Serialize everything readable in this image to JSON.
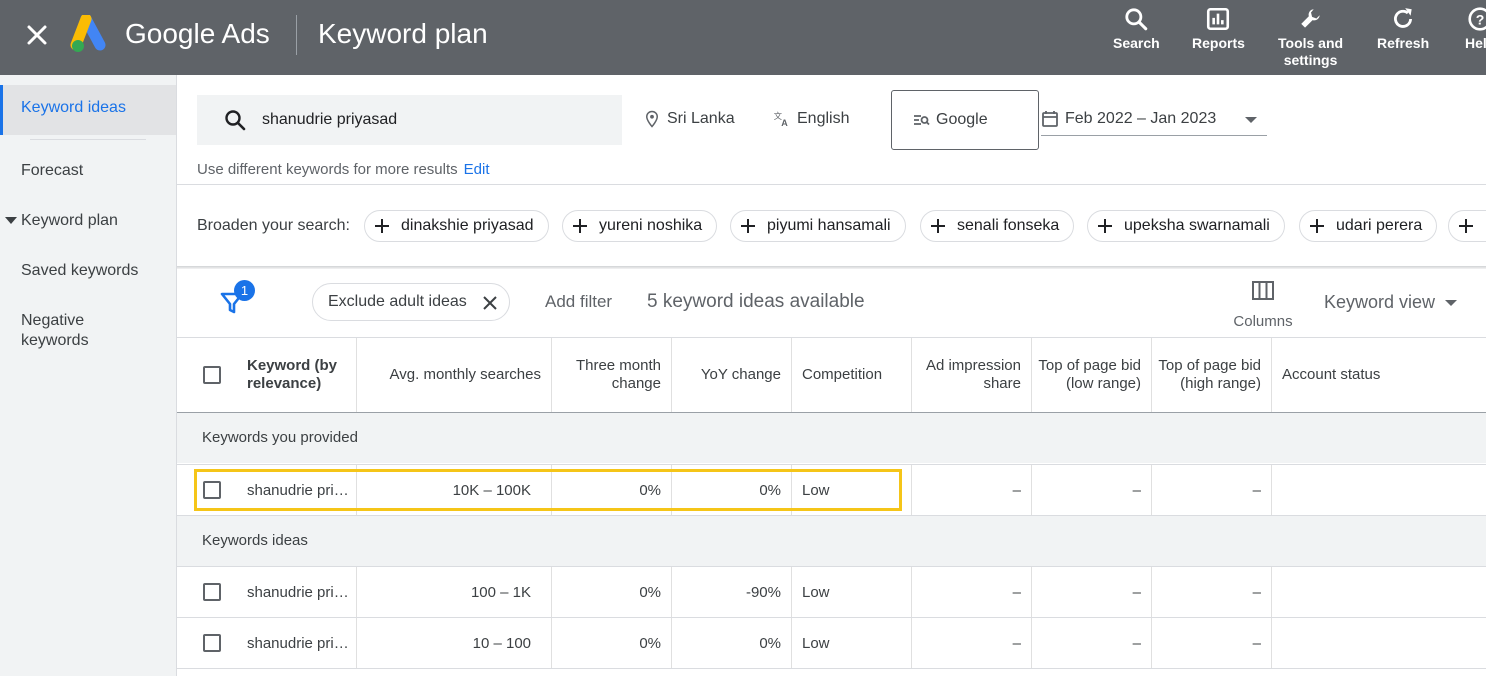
{
  "topbar": {
    "brand": "Google Ads",
    "title": "Keyword plan",
    "actions": [
      {
        "label": "Search",
        "icon": "search-icon"
      },
      {
        "label": "Reports",
        "icon": "reports-icon"
      },
      {
        "label": "Tools and\nsettings",
        "icon": "wrench-icon"
      },
      {
        "label": "Refresh",
        "icon": "refresh-icon"
      },
      {
        "label": "Help",
        "icon": "help-icon"
      }
    ]
  },
  "sidebar": {
    "items": [
      {
        "label": "Keyword ideas",
        "active": true
      },
      {
        "label": "Forecast"
      },
      {
        "label": "Keyword plan"
      },
      {
        "label": "Saved keywords"
      },
      {
        "label": "Negative\nkeywords"
      }
    ]
  },
  "search": {
    "query": "shanudrie priyasad",
    "location": "Sri Lanka",
    "language": "English",
    "network": "Google",
    "date_range": "Feb 2022 – Jan 2023",
    "hint": "Use different keywords for more results",
    "edit_label": "Edit"
  },
  "broaden": {
    "label": "Broaden your search:",
    "chips": [
      "dinakshie priyasad",
      "yureni noshika",
      "piyumi hansamali",
      "senali fonseka",
      "upeksha swarnamali",
      "udari perera"
    ]
  },
  "filters": {
    "badge": "1",
    "active_filter": "Exclude adult ideas",
    "add_filter": "Add filter",
    "count_text": "5 keyword ideas available",
    "columns_label": "Columns",
    "view_label": "Keyword view"
  },
  "table": {
    "headers": [
      "Keyword (by relevance)",
      "Avg. monthly searches",
      "Three month change",
      "YoY change",
      "Competition",
      "Ad impression share",
      "Top of page bid (low range)",
      "Top of page bid (high range)",
      "Account status"
    ],
    "section_provided": "Keywords you provided",
    "section_ideas": "Keywords ideas",
    "provided_rows": [
      {
        "keyword": "shanudrie pri…",
        "avg": "10K – 100K",
        "three": "0%",
        "yoy": "0%",
        "comp": "Low",
        "share": "–",
        "low": "–",
        "high": "–",
        "status": ""
      }
    ],
    "idea_rows": [
      {
        "keyword": "shanudrie pri…",
        "avg": "100 – 1K",
        "three": "0%",
        "yoy": "-90%",
        "comp": "Low",
        "share": "–",
        "low": "–",
        "high": "–",
        "status": ""
      },
      {
        "keyword": "shanudrie pri…",
        "avg": "10 – 100",
        "three": "0%",
        "yoy": "0%",
        "comp": "Low",
        "share": "–",
        "low": "–",
        "high": "–",
        "status": ""
      }
    ]
  },
  "colors": {
    "topbar": "#5f6368",
    "accent": "#1a73e8",
    "highlight": "#f5c518",
    "sidebar_bg": "#f1f3f4"
  }
}
